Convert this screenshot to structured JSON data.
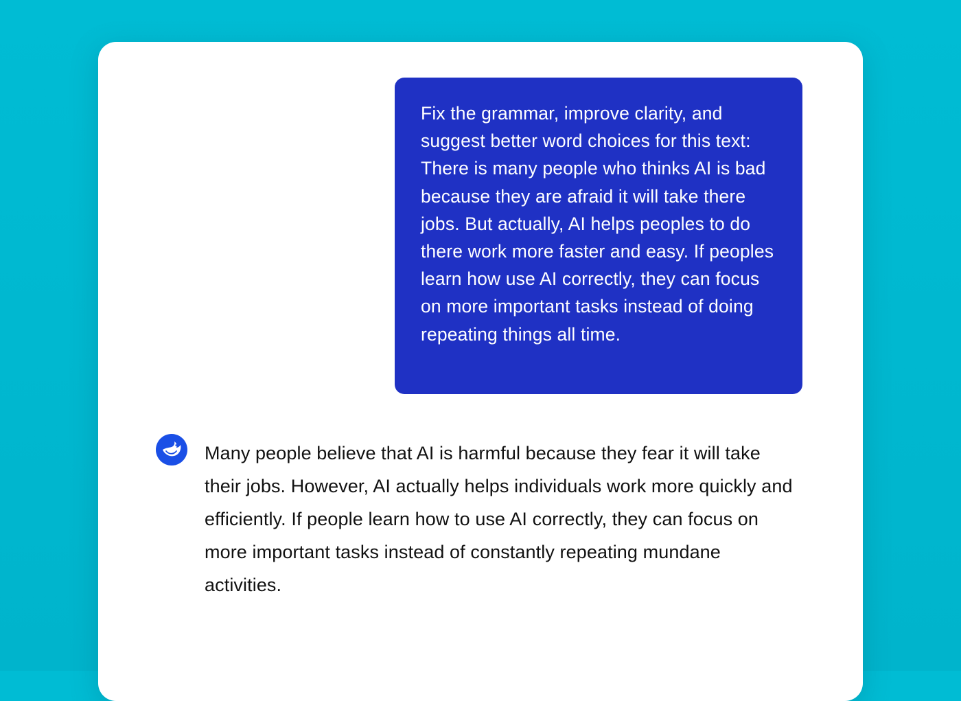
{
  "conversation": {
    "user_message": "Fix the grammar, improve clarity, and suggest better word choices for this text: There is many people who thinks AI is bad because they are afraid it will take there jobs. But actually, AI helps peoples to do there work more faster and easy. If peoples learn how use AI correctly, they can focus on more important tasks instead of doing repeating things all time.",
    "assistant_message": "Many people believe that AI is harmful because they fear it will take their jobs. However, AI actually helps individuals work more quickly and efficiently. If people learn how to use AI correctly, they can focus on more important tasks instead of constantly repeating mundane activities.",
    "assistant_avatar_icon": "whale-logo-icon"
  },
  "colors": {
    "background": "#00bcd4",
    "card": "#ffffff",
    "user_bubble": "#1f31c4",
    "avatar": "#1a4fe6"
  }
}
